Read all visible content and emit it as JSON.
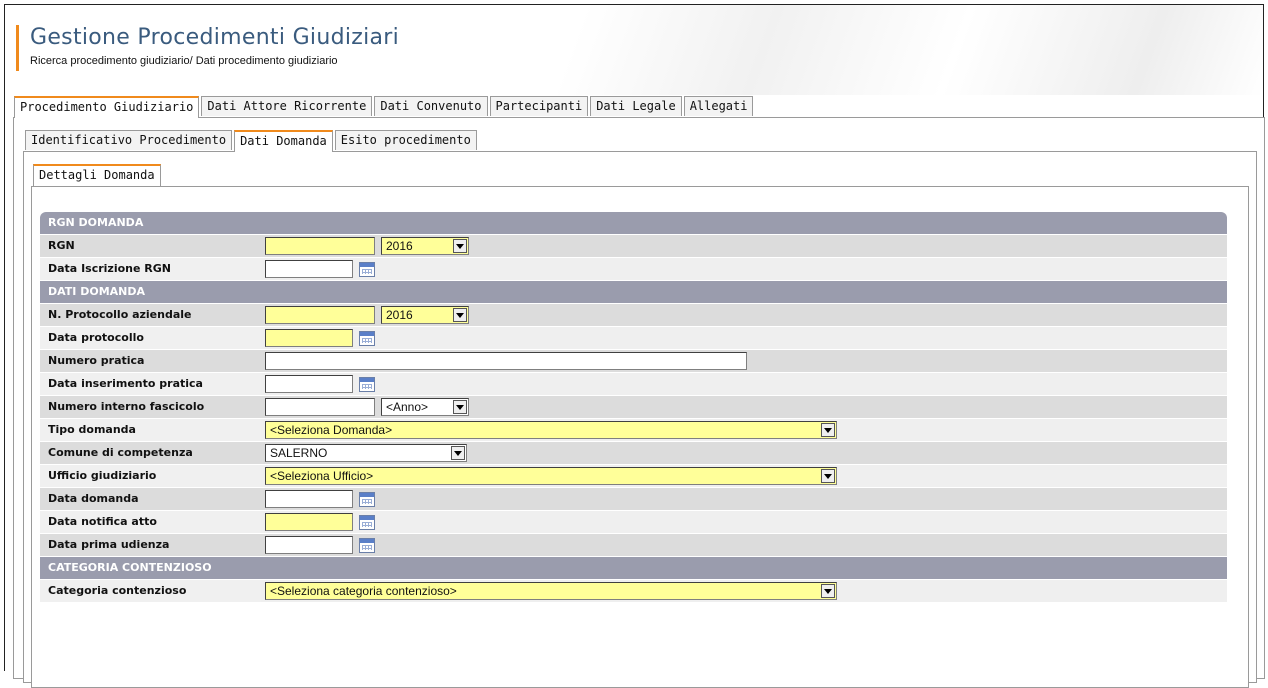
{
  "header": {
    "title": "Gestione Procedimenti Giudiziari",
    "breadcrumb": "Ricerca procedimento giudiziario/ Dati procedimento giudiziario"
  },
  "tabs_main": [
    {
      "label": "Procedimento Giudiziario",
      "active": true
    },
    {
      "label": "Dati Attore Ricorrente",
      "active": false
    },
    {
      "label": "Dati Convenuto",
      "active": false
    },
    {
      "label": "Partecipanti",
      "active": false
    },
    {
      "label": "Dati Legale",
      "active": false
    },
    {
      "label": "Allegati",
      "active": false
    }
  ],
  "tabs_sub": [
    {
      "label": "Identificativo Procedimento",
      "active": false
    },
    {
      "label": "Dati Domanda",
      "active": true
    },
    {
      "label": "Esito procedimento",
      "active": false
    }
  ],
  "tabs_detail": [
    {
      "label": "Dettagli Domanda",
      "active": true
    }
  ],
  "sections": {
    "rgn": "RGN DOMANDA",
    "dati": "DATI DOMANDA",
    "categoria": "CATEGORIA CONTENZIOSO"
  },
  "fields": {
    "rgn": {
      "label": "RGN",
      "value": "",
      "year": "2016"
    },
    "data_iscrizione_rgn": {
      "label": "Data Iscrizione RGN",
      "value": ""
    },
    "protocollo": {
      "label": "N. Protocollo aziendale",
      "value": "",
      "year": "2016"
    },
    "data_protocollo": {
      "label": "Data protocollo",
      "value": ""
    },
    "numero_pratica": {
      "label": "Numero pratica",
      "value": ""
    },
    "data_inserimento": {
      "label": "Data inserimento pratica",
      "value": ""
    },
    "numero_interno": {
      "label": "Numero interno fascicolo",
      "value": "",
      "year": "<Anno>"
    },
    "tipo_domanda": {
      "label": "Tipo domanda",
      "value": "<Seleziona Domanda>"
    },
    "comune": {
      "label": "Comune di competenza",
      "value": "SALERNO"
    },
    "ufficio": {
      "label": "Ufficio giudiziario",
      "value": "<Seleziona Ufficio>"
    },
    "data_domanda": {
      "label": "Data domanda",
      "value": ""
    },
    "data_notifica": {
      "label": "Data notifica atto",
      "value": ""
    },
    "data_udienza": {
      "label": "Data prima udienza",
      "value": ""
    },
    "categoria": {
      "label": "Categoria contenzioso",
      "value": "<Seleziona categoria contenzioso>"
    }
  },
  "colors": {
    "accent": "#f08a1c",
    "title": "#3a5b7e",
    "section_header": "#9a9cad",
    "required_field": "#ffff99"
  },
  "icons": {
    "calendar": "calendar-icon",
    "dropdown": "chevron-down-icon"
  }
}
